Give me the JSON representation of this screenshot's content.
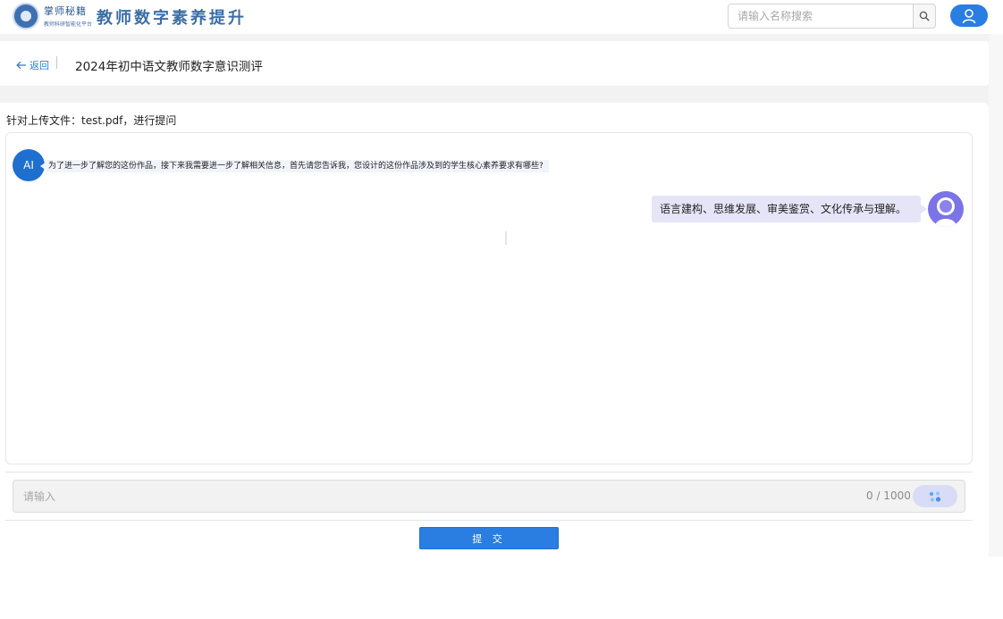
{
  "header": {
    "logo_script": "掌师秘籍",
    "logo_subtitle": "教师科研智能化平台",
    "site_title": "教师数字素养提升",
    "search": {
      "placeholder": "请输入名称搜索",
      "value": ""
    },
    "icons": {
      "search": "search-icon",
      "user": "user-icon"
    }
  },
  "title_bar": {
    "back_label": "返回",
    "page_title": "2024年初中语文教师数字意识测评"
  },
  "chat": {
    "prompt_label": "针对上传文件：test.pdf，进行提问",
    "messages": [
      {
        "role": "ai",
        "avatar_label": "AI",
        "text": "为了进一步了解您的这份作品，接下来我需要进一步了解相关信息，首先请您告诉我，您设计的这份作品涉及到的学生核心素养要求有哪些?"
      },
      {
        "role": "user",
        "text": "语言建构、思维发展、审美鉴赏、文化传承与理解。"
      }
    ]
  },
  "input": {
    "placeholder": "请输入",
    "value": "",
    "char_counter": "0 / 1000"
  },
  "actions": {
    "submit_label": "提 交"
  },
  "colors": {
    "accent": "#2a7de1",
    "ai_avatar": "#1e6fd0",
    "user_avatar": "#7b74e6",
    "user_bubble": "#e6e4f7",
    "ai_bubble": "#f1f4fa",
    "page_background": "#f2f2f2"
  }
}
